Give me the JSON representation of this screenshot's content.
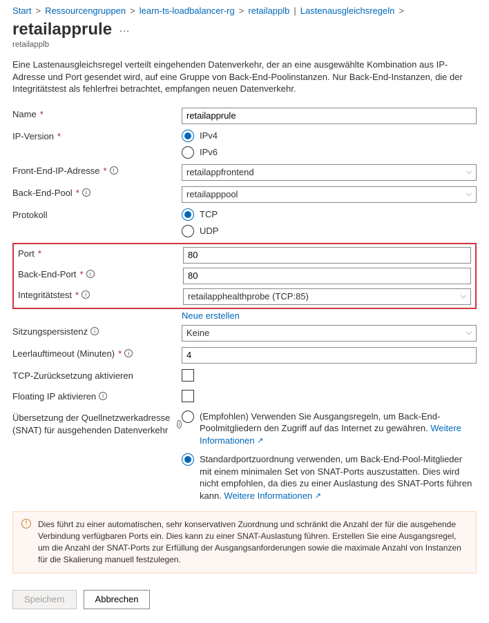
{
  "breadcrumb": {
    "start": "Start",
    "rg": "Ressourcengruppen",
    "learn": "learn-ts-loadbalancer-rg",
    "lb": "retailapplb",
    "sep": "|",
    "rules": "Lastenausgleichsregeln"
  },
  "title": "retailapprule",
  "ellipsis": "…",
  "subtitle": "retailapplb",
  "description": "Eine Lastenausgleichsregel verteilt eingehenden Datenverkehr, der an eine ausgewählte Kombination aus IP-Adresse und Port gesendet wird, auf eine Gruppe von Back-End-Poolinstanzen. Nur Back-End-Instanzen, die der Integritätstest als fehlerfrei betrachtet, empfangen neuen Datenverkehr.",
  "labels": {
    "name": "Name",
    "ipversion": "IP-Version",
    "frontend": "Front-End-IP-Adresse",
    "backend": "Back-End-Pool",
    "protocol": "Protokoll",
    "port": "Port",
    "beport": "Back-End-Port",
    "health": "Integritätstest",
    "newlink": "Neue erstellen",
    "session": "Sitzungspersistenz",
    "idle": "Leerlauftimeout (Minuten)",
    "tcpreset": "TCP-Zurücksetzung aktivieren",
    "floating": "Floating IP aktivieren",
    "snat": "Übersetzung der Quellnetzwerkadresse (SNAT) für ausgehenden Datenverkehr"
  },
  "values": {
    "name": "retailapprule",
    "frontend": "retailappfrontend",
    "backend": "retailapppool",
    "port": "80",
    "beport": "80",
    "health": "retailapphealthprobe (TCP:85)",
    "session": "Keine",
    "idle": "4"
  },
  "options": {
    "ipv4": "IPv4",
    "ipv6": "IPv6",
    "tcp": "TCP",
    "udp": "UDP"
  },
  "snat": {
    "opt1": "(Empfohlen) Verwenden Sie Ausgangsregeln, um Back-End-Poolmitgliedern den Zugriff auf das Internet zu gewähren. ",
    "opt2a": "Standardportzuordnung verwenden, um Back-End-Pool-Mitglieder mit einem minimalen Set von SNAT-Ports auszustatten. Dies wird nicht empfohlen, da dies zu einer Auslastung des SNAT-Ports führen kann. ",
    "more": "Weitere Informationen"
  },
  "warning": "Dies führt zu einer automatischen, sehr konservativen Zuordnung und schränkt die Anzahl der für die ausgehende Verbindung verfügbaren Ports ein. Dies kann zu einer SNAT-Auslastung führen. Erstellen Sie eine Ausgangsregel, um die Anzahl der SNAT-Ports zur Erfüllung der Ausgangsanforderungen sowie die maximale Anzahl von Instanzen für die Skalierung manuell festzulegen.",
  "buttons": {
    "save": "Speichern",
    "cancel": "Abbrechen"
  }
}
